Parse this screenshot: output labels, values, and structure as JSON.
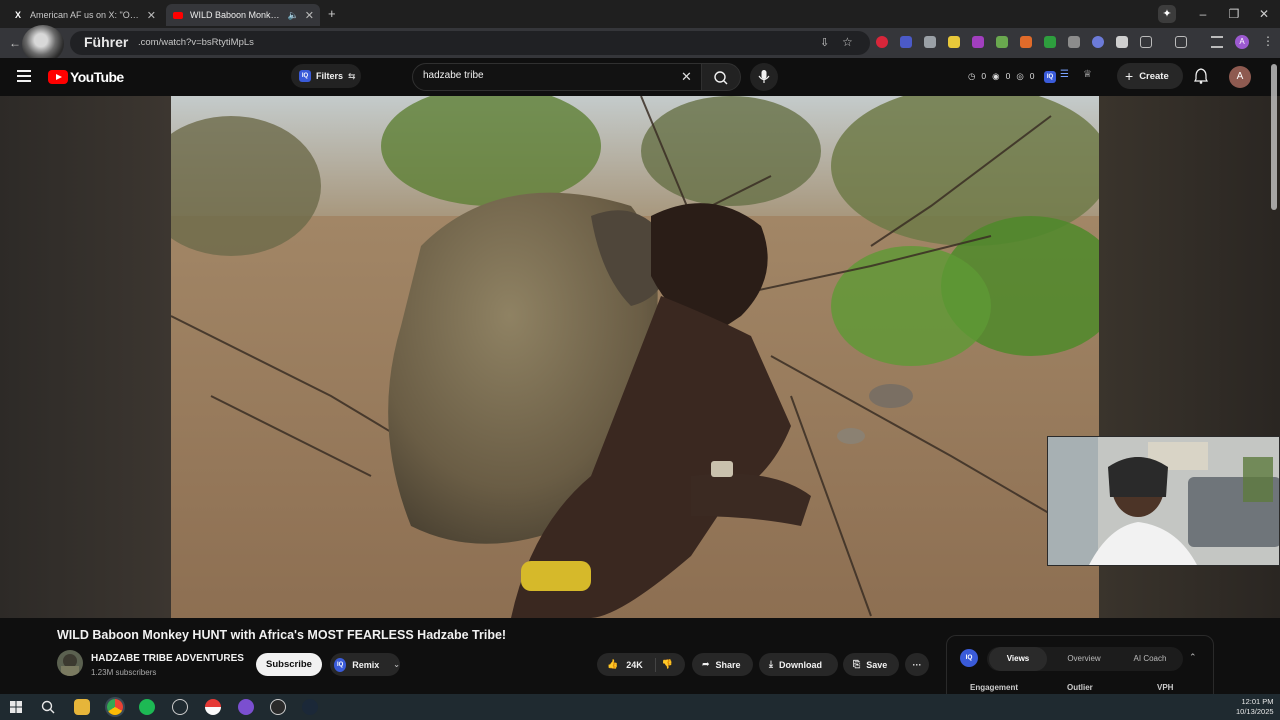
{
  "browser": {
    "tabs": [
      {
        "icon": "x-logo-icon",
        "title": "American AF us on X: \"One of t"
      },
      {
        "icon": "youtube-icon",
        "title": "WILD Baboon Monkey HUN"
      }
    ],
    "url": "youtube.com/watch?v=bsRtytiMpLs",
    "url_visible": ".com/watch?v=bsRtytiMpLs",
    "overlay_label": "Führer"
  },
  "youtube": {
    "logo_text": "YouTube",
    "filters_label": "Filters",
    "search_value": "hadzabe tribe",
    "stats": [
      {
        "icon": "clock-icon",
        "value": "0"
      },
      {
        "icon": "eye-icon",
        "value": "0"
      },
      {
        "icon": "eye-off-icon",
        "value": "0"
      }
    ],
    "create_label": "Create",
    "avatar_letter": "A"
  },
  "video": {
    "title": "WILD Baboon Monkey HUNT with Africa's MOST FEARLESS Hadzabe Tribe!",
    "channel_name": "HADZABE TRIBE ADVENTURES",
    "subscribers": "1.23M subscribers",
    "subscribe_label": "Subscribe",
    "remix_label": "Remix",
    "likes": "24K",
    "share_label": "Share",
    "download_label": "Download",
    "save_label": "Save"
  },
  "iq_panel": {
    "logo": "IQ",
    "tabs": [
      "Views",
      "Overview",
      "AI Coach"
    ],
    "active_tab": "Views",
    "columns": [
      "Engagement",
      "Outlier",
      "VPH"
    ]
  },
  "taskbar": {
    "time": "12:01 PM",
    "date": "10/13/2025"
  },
  "colors": {
    "youtube_red": "#ff0000",
    "iq_blue": "#3a5bd9",
    "background": "#0f0f0f"
  }
}
